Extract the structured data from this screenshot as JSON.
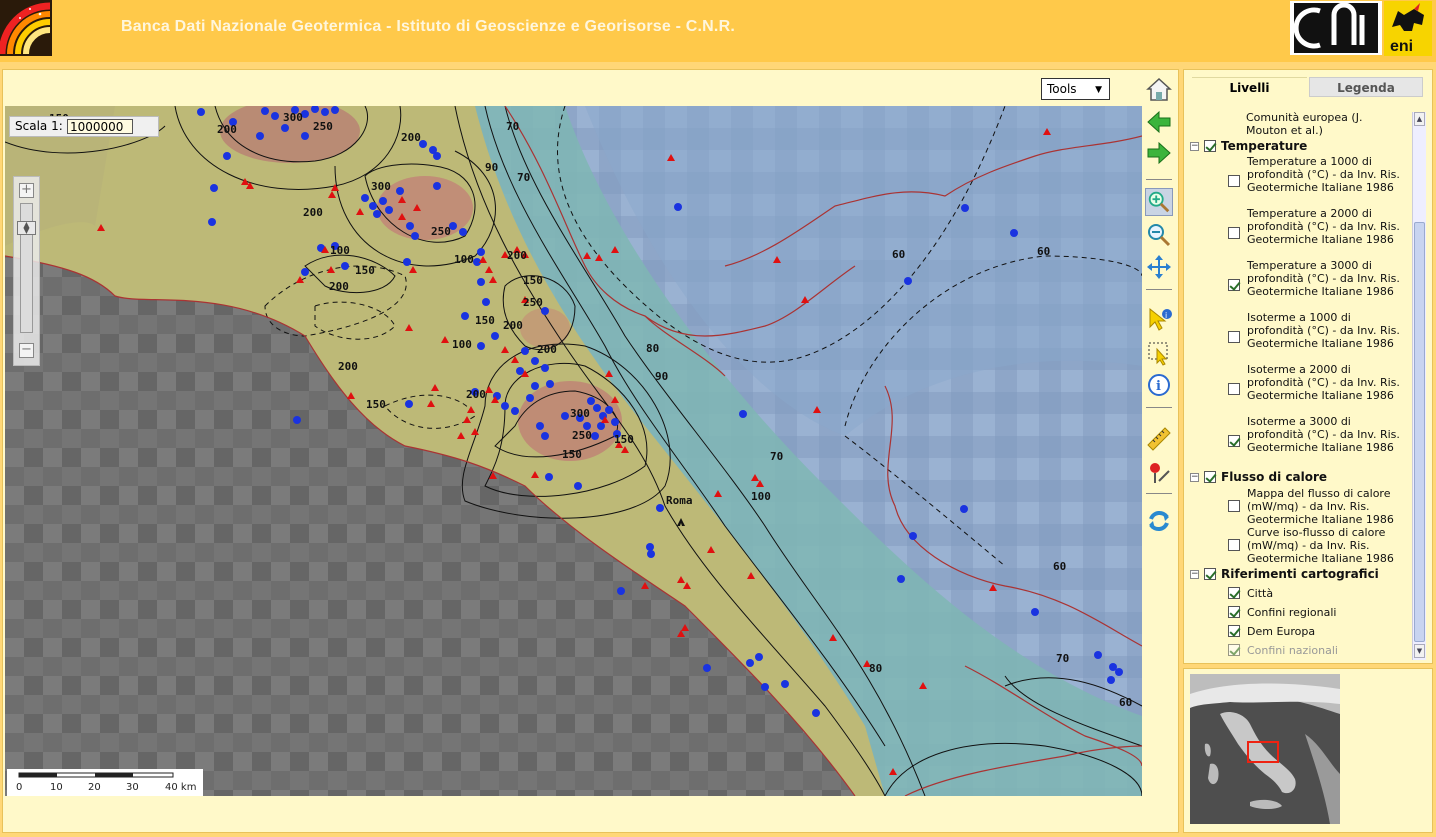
{
  "header": {
    "title": "Banca Dati Nazionale Geotermica -  Istituto di Geoscienze e Georisorse - C.N.R."
  },
  "map": {
    "tools_label": "Tools",
    "scale_label": "Scala 1:",
    "scale_value": "1000000",
    "scalebar_ticks": [
      "0",
      "10",
      "20",
      "30",
      "40 km"
    ],
    "city_label": "Roma",
    "contour_labels": [
      "150",
      "200",
      "300",
      "250",
      "200",
      "300",
      "200",
      "250",
      "100",
      "150",
      "200",
      "100",
      "150",
      "200",
      "250",
      "150",
      "200",
      "100",
      "200",
      "200",
      "200",
      "150",
      "300",
      "250",
      "150",
      "150",
      "70",
      "90",
      "70",
      "60",
      "60",
      "80",
      "90",
      "70",
      "100",
      "60",
      "70",
      "60",
      "80"
    ]
  },
  "toolbar": {
    "home": "home-icon",
    "back": "back-arrow-icon",
    "forward": "forward-arrow-icon",
    "zoom_in": "zoom-in-icon",
    "zoom_out": "zoom-out-icon",
    "pan": "pan-icon",
    "identify": "identify-icon",
    "select": "select-icon",
    "info": "info-icon",
    "measure": "measure-icon",
    "locate": "locate-icon",
    "refresh": "refresh-icon"
  },
  "layers": {
    "tabs": [
      "Livelli",
      "Legenda"
    ],
    "top_item": "Comunità europea (J. Mouton et al.)",
    "groups": [
      {
        "label": "Temperature",
        "items": [
          {
            "label": "Temperature a 1000 di profondità (°C) - da Inv. Ris. Geotermiche Italiane 1986",
            "checked": false
          },
          {
            "label": "Temperature a 2000 di profondità (°C) - da Inv. Ris. Geotermiche Italiane 1986",
            "checked": false
          },
          {
            "label": "Temperature a 3000 di profondità (°C) - da Inv. Ris. Geotermiche Italiane 1986",
            "checked": true
          },
          {
            "label": "Isoterme a 1000 di profondità (°C) - da Inv. Ris. Geotermiche Italiane 1986",
            "checked": false
          },
          {
            "label": "Isoterme a 2000 di profondità (°C) - da Inv. Ris. Geotermiche Italiane 1986",
            "checked": false
          },
          {
            "label": "Isoterme a 3000 di profondità (°C) - da Inv. Ris. Geotermiche Italiane 1986",
            "checked": true
          }
        ]
      },
      {
        "label": "Flusso di calore",
        "items": [
          {
            "label": "Mappa del flusso di calore (mW/mq) - da Inv. Ris. Geotermiche Italiane 1986",
            "checked": false
          },
          {
            "label": "Curve iso-flusso di calore (mW/mq) - da Inv. Ris. Geotermiche Italiane 1986",
            "checked": false
          }
        ]
      },
      {
        "label": "Riferimenti cartografici",
        "items": [
          {
            "label": "Città",
            "checked": true
          },
          {
            "label": "Confini regionali",
            "checked": true
          },
          {
            "label": "Dem Europa",
            "checked": true
          },
          {
            "label": "Confini nazionali",
            "checked": true,
            "disabled": true
          }
        ]
      }
    ]
  }
}
